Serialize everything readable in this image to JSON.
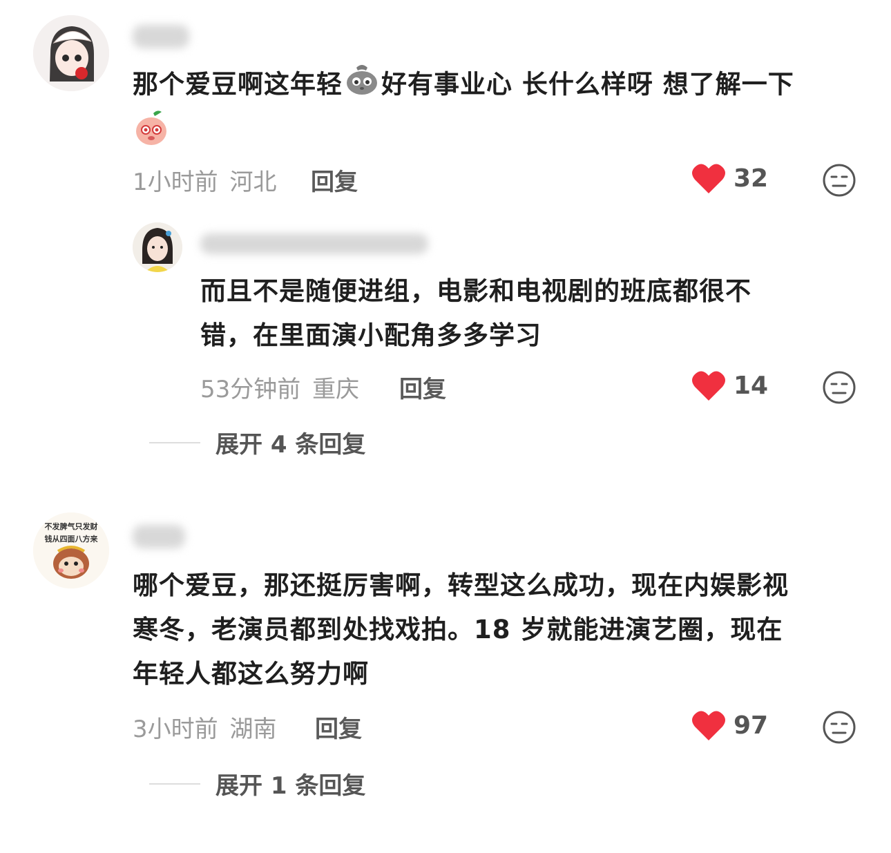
{
  "comments": [
    {
      "text_part1": "那个爱豆啊这年轻",
      "text_part2": "好有事业心 长什么样呀 想了解一下",
      "time": "1小时前",
      "location": "河北",
      "reply_label": "回复",
      "likes": "32",
      "reply": {
        "text_line1": "而且不是随便进组，电影和电视剧的班底都很不",
        "text_line2": "错，在里面演小配角多多学习",
        "time": "53分钟前",
        "location": "重庆",
        "reply_label": "回复",
        "likes": "14"
      },
      "expand_label": "展开 4 条回复"
    },
    {
      "avatar_text_line1": "不发脾气只发财",
      "avatar_text_line2": "钱从四面八方来",
      "text_line1": "哪个爱豆，那还挺厉害啊，转型这么成功，现在内娱影视",
      "text_line2": "寒冬，老演员都到处找戏拍。18 岁就能进演艺圈，现在",
      "text_line3": "年轻人都这么努力啊",
      "time": "3小时前",
      "location": "湖南",
      "reply_label": "回复",
      "likes": "97",
      "expand_label": "展开 1 条回复"
    }
  ],
  "colors": {
    "heart": "#f0303f",
    "meta": "#9a9a9a"
  },
  "icons": [
    "heart-icon",
    "dislike-face-icon",
    "pleading-bag-emoji",
    "peach-emoji"
  ]
}
